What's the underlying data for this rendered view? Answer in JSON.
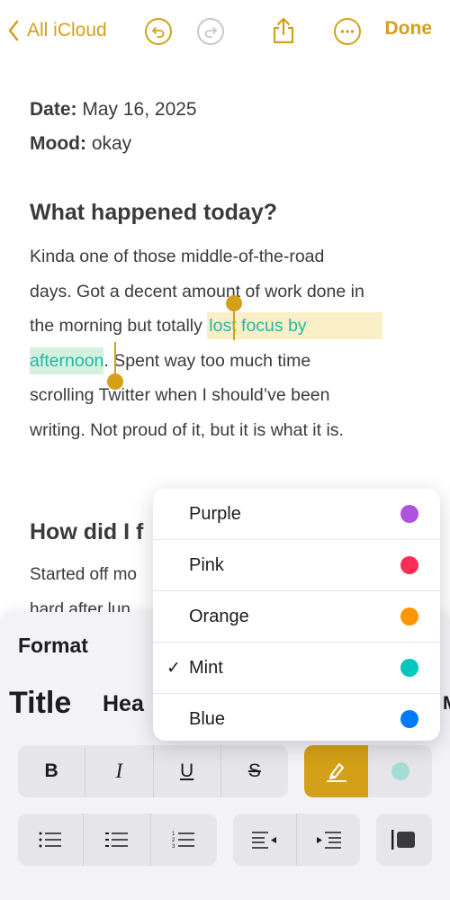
{
  "nav": {
    "back_label": "All iCloud",
    "done_label": "Done"
  },
  "note": {
    "date_label": "Date:",
    "date_value": "May 16, 2025",
    "mood_label": "Mood:",
    "mood_value": "okay",
    "heading1": "What happened today?",
    "p1_line1": "Kinda one of those middle-of-the-road",
    "p1_line2": "days. Got a decent amount of work done in",
    "p1_line3_pre": "the morning but totally ",
    "p1_sel_a": "lost focus by",
    "p1_sel_b": "afternoon",
    "p1_line4_post": ". Spent way too much time",
    "p1_line5": "scrolling Twitter when I should’ve been",
    "p1_line6": "writing. Not proud of it, but it is what it is.",
    "heading2": "How did I f",
    "p2_line1": "Started off mo",
    "p2_line2": "hard after lun"
  },
  "format_panel": {
    "title": "Format",
    "styles": [
      "Title",
      "Hea"
    ],
    "bold": "B",
    "italic": "I",
    "underline": "U",
    "strike": "S"
  },
  "color_menu": {
    "selected": "Mint",
    "check_glyph": "✓",
    "items": [
      {
        "label": "Purple",
        "color": "#af52de"
      },
      {
        "label": "Pink",
        "color": "#ff2d55"
      },
      {
        "label": "Orange",
        "color": "#ff9500"
      },
      {
        "label": "Mint",
        "color": "#00c7be"
      },
      {
        "label": "Blue",
        "color": "#007aff"
      }
    ]
  },
  "colors": {
    "accent": "#d4a017",
    "mint": "#1fb8a8"
  }
}
